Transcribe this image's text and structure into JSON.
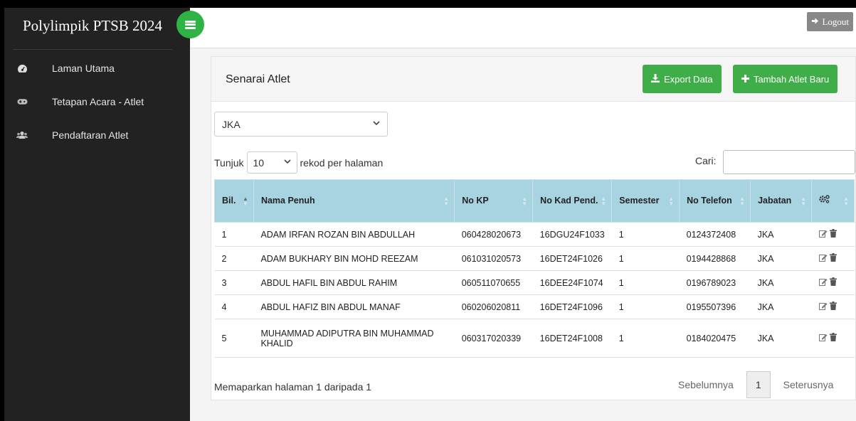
{
  "app": {
    "brand": "Polylimpik PTSB 2024",
    "logout_label": "Logout"
  },
  "sidebar": {
    "items": [
      {
        "label": "Laman Utama",
        "icon": "dashboard-icon"
      },
      {
        "label": "Tetapan Acara - Atlet",
        "icon": "gamepad-icon"
      },
      {
        "label": "Pendaftaran Atlet",
        "icon": "users-icon"
      }
    ]
  },
  "panel": {
    "title": "Senarai Atlet",
    "export_label": "Export Data",
    "add_label": "Tambah Atlet Baru",
    "filter_value": "JKA",
    "length_prefix": "Tunjuk",
    "length_value": "10",
    "length_suffix": "rekod per halaman",
    "search_label": "Cari:",
    "search_value": ""
  },
  "table": {
    "headers": {
      "bil": "Bil.",
      "nama": "Nama Penuh",
      "no_kp": "No KP",
      "no_kad": "No Kad Pend.",
      "semester": "Semester",
      "telefon": "No Telefon",
      "jabatan": "Jabatan",
      "actions_icon": "cogs-icon"
    },
    "rows": [
      {
        "bil": "1",
        "nama": "ADAM IRFAN ROZAN BIN ABDULLAH",
        "no_kp": "060428020673",
        "no_kad": "16DGU24F1033",
        "semester": "1",
        "telefon": "0124372408",
        "jabatan": "JKA"
      },
      {
        "bil": "2",
        "nama": "ADAM BUKHARY BIN MOHD REEZAM",
        "no_kp": "061031020573",
        "no_kad": "16DET24F1026",
        "semester": "1",
        "telefon": "0194428868",
        "jabatan": "JKA"
      },
      {
        "bil": "3",
        "nama": "ABDUL HAFIL BIN ABDUL RAHIM",
        "no_kp": "060511070655",
        "no_kad": "16DEE24F1074",
        "semester": "1",
        "telefon": "0196789023",
        "jabatan": "JKA"
      },
      {
        "bil": "4",
        "nama": "ABDUL HAFIZ BIN ABDUL MANAF",
        "no_kp": "060206020811",
        "no_kad": "16DET24F1096",
        "semester": "1",
        "telefon": "0195507396",
        "jabatan": "JKA"
      },
      {
        "bil": "5",
        "nama": "MUHAMMAD ADIPUTRA BIN MUHAMMAD KHALID",
        "no_kp": "060317020339",
        "no_kad": "16DET24F1008",
        "semester": "1",
        "telefon": "0184020475",
        "jabatan": "JKA"
      }
    ]
  },
  "footer": {
    "info": "Memaparkan halaman 1 daripada 1",
    "prev_label": "Sebelumnya",
    "page": "1",
    "next_label": "Seterusnya"
  },
  "colors": {
    "sidebar_bg": "#222222",
    "accent_green": "#3fae49",
    "table_header": "#a8d4e2"
  }
}
